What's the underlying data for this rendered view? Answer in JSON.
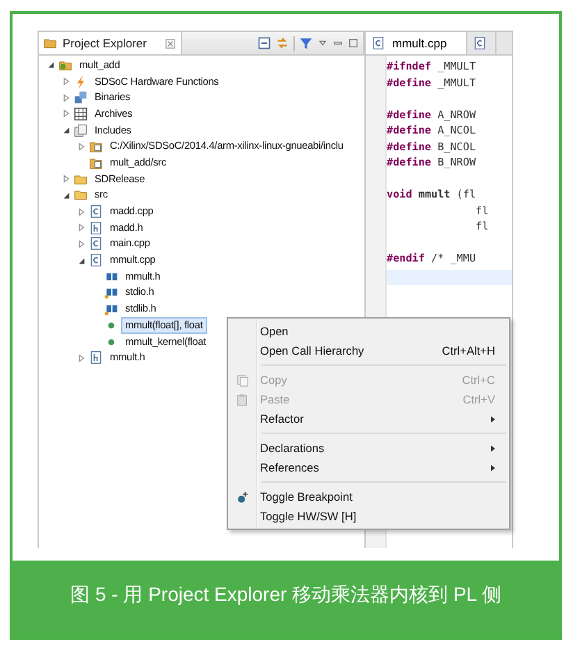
{
  "explorer": {
    "title": "Project Explorer",
    "tree": [
      {
        "label": "mult_add",
        "kind": "project",
        "expanded": true,
        "selected": false,
        "children": [
          {
            "label": "SDSoC Hardware Functions",
            "kind": "hw",
            "expanded": false,
            "selected": false
          },
          {
            "label": "Binaries",
            "kind": "binaries",
            "expanded": false,
            "selected": false
          },
          {
            "label": "Archives",
            "kind": "archives",
            "expanded": false,
            "selected": false
          },
          {
            "label": "Includes",
            "kind": "includes",
            "expanded": true,
            "selected": false,
            "children": [
              {
                "label": "C:/Xilinx/SDSoC/2014.4/arm-xilinx-linux-gnueabi/inclu",
                "kind": "incfolder",
                "expanded": false,
                "selected": false
              },
              {
                "label": "mult_add/src",
                "kind": "incfolder",
                "selected": false
              }
            ]
          },
          {
            "label": "SDRelease",
            "kind": "folder",
            "expanded": false,
            "selected": false
          },
          {
            "label": "src",
            "kind": "folder",
            "expanded": true,
            "selected": false,
            "children": [
              {
                "label": "madd.cpp",
                "kind": "cfile",
                "expanded": false,
                "selected": false
              },
              {
                "label": "madd.h",
                "kind": "hfile",
                "expanded": false,
                "selected": false
              },
              {
                "label": "main.cpp",
                "kind": "cfile",
                "expanded": false,
                "selected": false
              },
              {
                "label": "mmult.cpp",
                "kind": "cfile",
                "expanded": true,
                "selected": false,
                "children": [
                  {
                    "label": "mmult.h",
                    "kind": "include",
                    "selected": false
                  },
                  {
                    "label": "stdio.h",
                    "kind": "sysinclude",
                    "selected": false
                  },
                  {
                    "label": "stdlib.h",
                    "kind": "sysinclude",
                    "selected": false
                  },
                  {
                    "label": "mmult(float[], float",
                    "kind": "function",
                    "selected": true
                  },
                  {
                    "label": "mmult_kernel(float",
                    "kind": "function",
                    "selected": false
                  }
                ]
              },
              {
                "label": "mmult.h",
                "kind": "hfile",
                "expanded": false,
                "selected": false
              }
            ]
          }
        ]
      }
    ]
  },
  "editor": {
    "tabs": [
      {
        "label": "mmult.cpp",
        "selected": true
      },
      {
        "selected": false
      }
    ],
    "lines": [
      {
        "kind": "code",
        "keyword": "#ifndef",
        "text": " _MMULT"
      },
      {
        "kind": "code",
        "keyword": "#define",
        "text": " _MMULT"
      },
      {
        "kind": "blank"
      },
      {
        "kind": "code",
        "keyword": "#define",
        "text": " A_NROW"
      },
      {
        "kind": "code",
        "keyword": "#define",
        "text": " A_NCOL"
      },
      {
        "kind": "code",
        "keyword": "#define",
        "text": " B_NCOL"
      },
      {
        "kind": "code",
        "keyword": "#define",
        "text": " B_NROW"
      },
      {
        "kind": "blank"
      },
      {
        "kind": "code",
        "keyword": "void",
        "text": " **mmult** (fl"
      },
      {
        "kind": "code",
        "text": "              fl"
      },
      {
        "kind": "code",
        "text": "              fl"
      },
      {
        "kind": "blank"
      },
      {
        "kind": "code",
        "keyword": "#endif",
        "text": " /* _MMU"
      },
      {
        "kind": "current"
      }
    ]
  },
  "context_menu": {
    "items": [
      {
        "kind": "item",
        "label": "Open",
        "disabled": false
      },
      {
        "kind": "item",
        "label": "Open Call Hierarchy",
        "shortcut": "Ctrl+Alt+H",
        "disabled": false
      },
      {
        "kind": "separator"
      },
      {
        "kind": "copy",
        "label": "Copy",
        "shortcut": "Ctrl+C",
        "disabled": true
      },
      {
        "kind": "paste",
        "label": "Paste",
        "shortcut": "Ctrl+V",
        "disabled": true
      },
      {
        "kind": "item",
        "label": "Refactor",
        "submenu": true,
        "disabled": false
      },
      {
        "kind": "separator"
      },
      {
        "kind": "item",
        "label": "Declarations",
        "submenu": true,
        "disabled": false
      },
      {
        "kind": "item",
        "label": "References",
        "submenu": true,
        "disabled": false
      },
      {
        "kind": "separator"
      },
      {
        "kind": "breakpoint",
        "label": "Toggle Breakpoint",
        "disabled": false
      },
      {
        "kind": "item",
        "label": "Toggle HW/SW [H]",
        "disabled": false
      }
    ]
  },
  "caption": "图 5 - 用 Project Explorer 移动乘法器内核到 PL 侧"
}
